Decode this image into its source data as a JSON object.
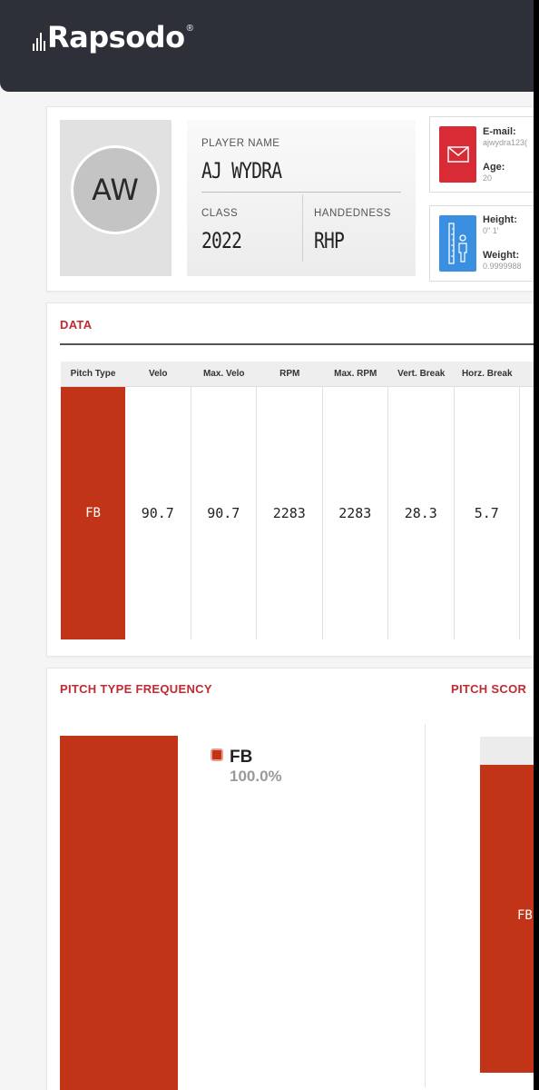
{
  "brand": {
    "name": "Rapsodo",
    "reg": "®"
  },
  "player": {
    "initials": "AW",
    "name_label": "PLAYER NAME",
    "name": "AJ WYDRA",
    "class_label": "CLASS",
    "class": "2022",
    "handedness_label": "HANDEDNESS",
    "handedness": "RHP"
  },
  "contact": {
    "email_label": "E-mail:",
    "email": "ajwydra123(",
    "age_label": "Age:",
    "age": "20",
    "height_label": "Height:",
    "height": "0\" 1'",
    "weight_label": "Weight:",
    "weight": "0.9999988"
  },
  "data_section": {
    "title": "DATA",
    "columns": [
      "Pitch Type",
      "Velo",
      "Max. Velo",
      "RPM",
      "Max. RPM",
      "Vert. Break",
      "Horz. Break"
    ],
    "rows": [
      {
        "pitch_type": "FB",
        "velo": "90.7",
        "max_velo": "90.7",
        "rpm": "2283",
        "max_rpm": "2283",
        "vert_break": "28.3",
        "horz_break": "5.7"
      }
    ]
  },
  "frequency": {
    "title": "PITCH TYPE FREQUENCY",
    "legend_label": "FB",
    "legend_value": "100.0%",
    "share_percent": 100
  },
  "score": {
    "title": "PITCH SCOR",
    "bar_label": "FB"
  },
  "colors": {
    "accent": "#c23418",
    "title_red": "#c02a32",
    "header_bg": "#2e3039",
    "email_icon": "#d92b36",
    "height_icon": "#3b8fe0"
  },
  "icons": {
    "email": "envelope-icon",
    "height": "height-ruler-icon"
  }
}
